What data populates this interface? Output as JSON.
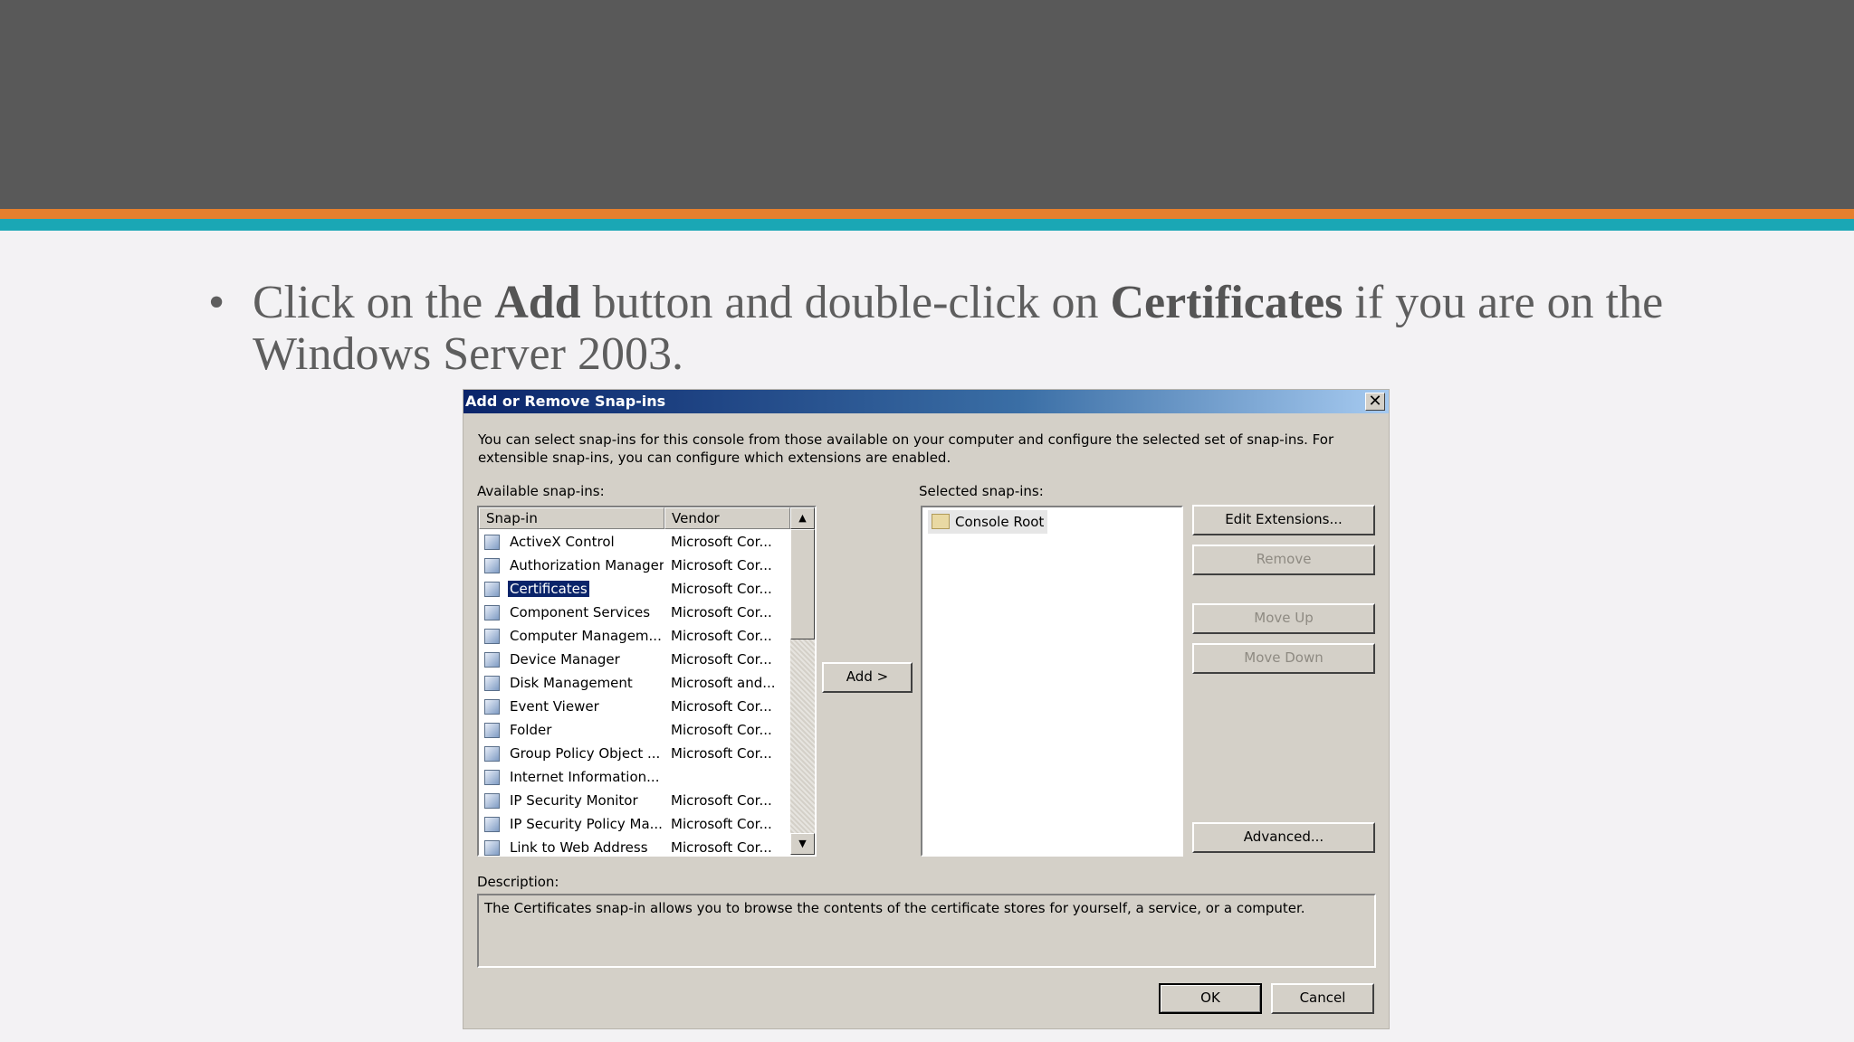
{
  "slide": {
    "bullet_prefix": "Click on the ",
    "bullet_bold1": "Add",
    "bullet_mid": " button and double-click on ",
    "bullet_bold2": "Certificates",
    "bullet_suffix": " if you are on the Windows Server 2003.",
    "colors": {
      "top_band": "#595959",
      "orange_stripe": "#e57f2d",
      "teal_stripe": "#1aa7b5"
    }
  },
  "dialog": {
    "title": "Add or Remove Snap-ins",
    "close_glyph": "✕",
    "intro": "You can select snap-ins for this console from those available on your computer and configure the selected set of snap-ins. For extensible snap-ins, you can configure which extensions are enabled.",
    "available_label": "Available snap-ins:",
    "selected_label": "Selected snap-ins:",
    "columns": [
      "Snap-in",
      "Vendor"
    ],
    "snapins": [
      {
        "name": "ActiveX Control",
        "vendor": "Microsoft Cor...",
        "selected": false
      },
      {
        "name": "Authorization Manager",
        "vendor": "Microsoft Cor...",
        "selected": false
      },
      {
        "name": "Certificates",
        "vendor": "Microsoft Cor...",
        "selected": true
      },
      {
        "name": "Component Services",
        "vendor": "Microsoft Cor...",
        "selected": false
      },
      {
        "name": "Computer Managem...",
        "vendor": "Microsoft Cor...",
        "selected": false
      },
      {
        "name": "Device Manager",
        "vendor": "Microsoft Cor...",
        "selected": false
      },
      {
        "name": "Disk Management",
        "vendor": "Microsoft and...",
        "selected": false
      },
      {
        "name": "Event Viewer",
        "vendor": "Microsoft Cor...",
        "selected": false
      },
      {
        "name": "Folder",
        "vendor": "Microsoft Cor...",
        "selected": false
      },
      {
        "name": "Group Policy Object ...",
        "vendor": "Microsoft Cor...",
        "selected": false
      },
      {
        "name": "Internet Information...",
        "vendor": "",
        "selected": false
      },
      {
        "name": "IP Security Monitor",
        "vendor": "Microsoft Cor...",
        "selected": false
      },
      {
        "name": "IP Security Policy Ma...",
        "vendor": "Microsoft Cor...",
        "selected": false
      },
      {
        "name": "Link to Web Address",
        "vendor": "Microsoft Cor...",
        "selected": false
      }
    ],
    "selected_item": "Console Root",
    "add_button": "Add >",
    "buttons": {
      "edit_extensions": "Edit Extensions...",
      "remove": "Remove",
      "move_up": "Move Up",
      "move_down": "Move Down",
      "advanced": "Advanced..."
    },
    "description_label": "Description:",
    "description": "The Certificates snap-in allows you to browse the contents of the certificate stores for yourself, a service, or a computer.",
    "ok": "OK",
    "cancel": "Cancel",
    "scroll_up_glyph": "▲",
    "scroll_down_glyph": "▼"
  }
}
